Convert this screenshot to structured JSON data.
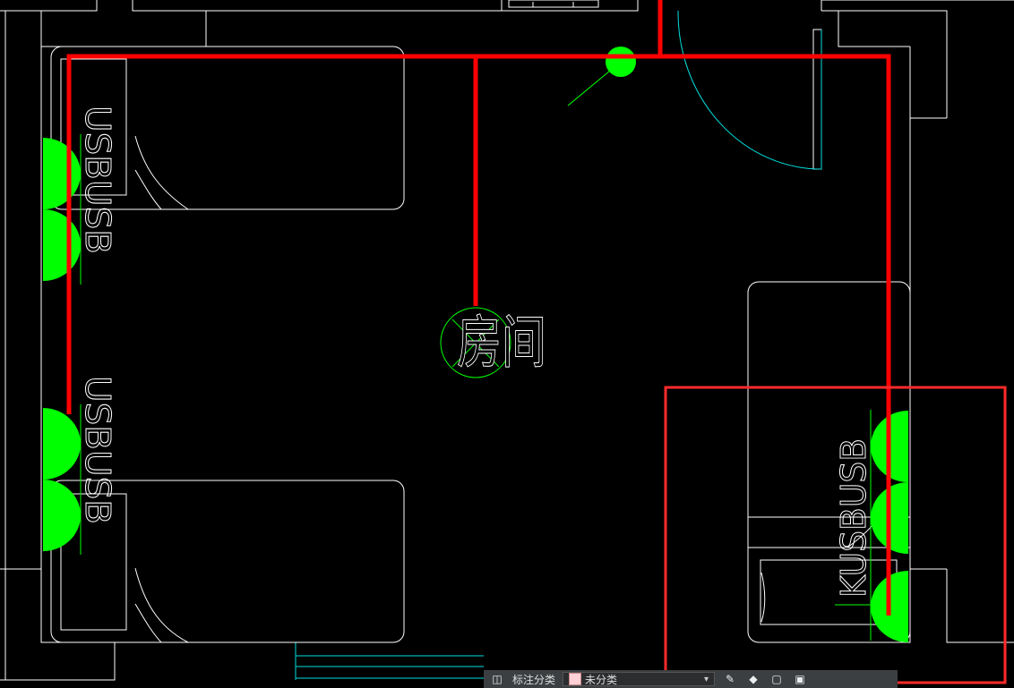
{
  "colors": {
    "background": "#000000",
    "walls": "#ffffff",
    "door_swing": "#00ffff",
    "sockets": "#00ff00",
    "wiring": "#ff0000",
    "selection_box": "#ff2a2a"
  },
  "room": {
    "name": "房间"
  },
  "sockets": {
    "left_upper_label": "USBUSB",
    "left_lower_label": "USBUSB",
    "right_label": "KUSBUSB"
  },
  "statusbar": {
    "annotation_label": "标注分类",
    "category_label": "未分类",
    "icons": [
      "layers-icon",
      "edit-icon",
      "diamond-icon",
      "box-icon",
      "lock-icon"
    ]
  }
}
